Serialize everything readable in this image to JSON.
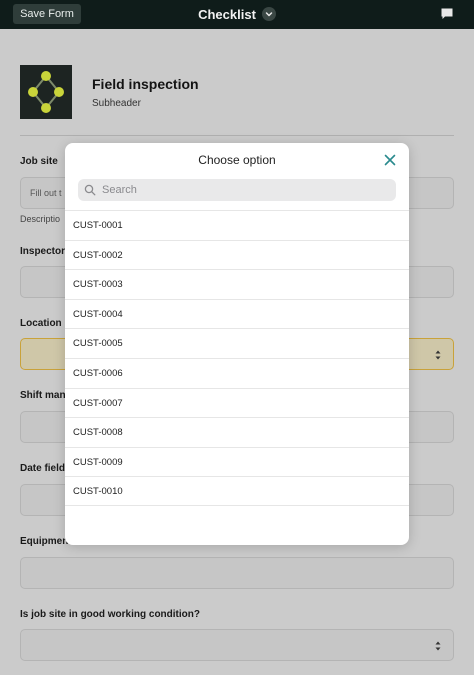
{
  "topbar": {
    "save_label": "Save Form",
    "title": "Checklist"
  },
  "form": {
    "title": "Field inspection",
    "subheader": "Subheader",
    "fields": [
      {
        "label": "Job site",
        "placeholder": "Fill out t",
        "description": "Descriptio"
      },
      {
        "label": "Inspector"
      },
      {
        "label": "Location"
      },
      {
        "label": "Shift mana"
      },
      {
        "label": "Date field"
      },
      {
        "label": "Equipment"
      },
      {
        "label": "Is job site in good working condition?"
      }
    ]
  },
  "modal": {
    "title": "Choose option",
    "search_placeholder": "Search",
    "options": [
      "CUST-0001",
      "CUST-0002",
      "CUST-0003",
      "CUST-0004",
      "CUST-0005",
      "CUST-0006",
      "CUST-0007",
      "CUST-0008",
      "CUST-0009",
      "CUST-0010"
    ]
  },
  "colors": {
    "topbar": "#0f1c1a",
    "accent": "#2a8a8e",
    "logo_node": "#c9d43a",
    "highlight_border": "#c9a23a"
  }
}
